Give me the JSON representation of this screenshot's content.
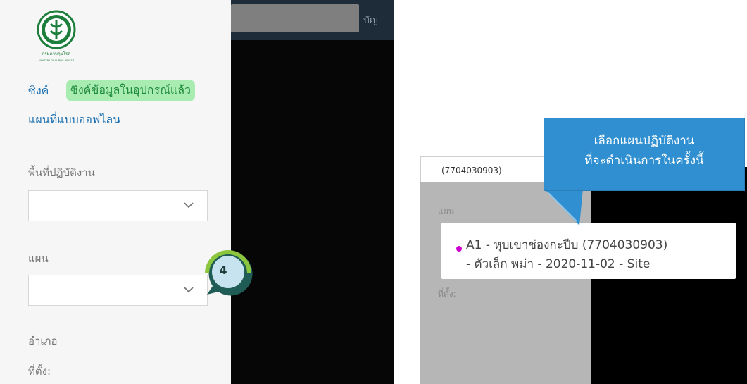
{
  "sidebar": {
    "logo": {
      "caption1": "กรมควบคุมโรค",
      "caption2": "MINISTRY OF PUBLIC HEALTH"
    },
    "sync_label": "ซิงค์",
    "sync_status": "ซิงค์ข้อมูลในอุปกรณ์แล้ว",
    "offline_map_label": "แผนที่แบบออฟไลน",
    "area_label": "พื้นที่ปฏิบัติงาน",
    "plan_label": "แผน",
    "district_label": "อำเภอ",
    "location_label": "ที่ตั้ง:"
  },
  "topbar": {
    "text": "บัญ"
  },
  "step_badge": {
    "number": "4"
  },
  "panel2": {
    "field_value": "(7704030903)",
    "plan_label": "แผน",
    "location_label": "ที่ตั้ง:"
  },
  "option": {
    "line1": "A1 - หุบเขาช่องกะปีบ (7704030903)",
    "line2": "- ตัวเล็ก พม่า - 2020-11-02 - Site"
  },
  "tooltip": {
    "line1": "เลือกแผนปฏิบัติงาน",
    "line2": "ที่จะดำเนินการในครั้งนี้"
  },
  "colors": {
    "accent_blue": "#2f8fd0",
    "sync_green": "#a8ecb2",
    "option_dot": "#d000d0",
    "badge_green": "#8cc63f",
    "badge_teal": "#1f5c55"
  },
  "icons": [
    "ministry-logo-icon",
    "chevron-down-icon",
    "step-badge-icon"
  ]
}
